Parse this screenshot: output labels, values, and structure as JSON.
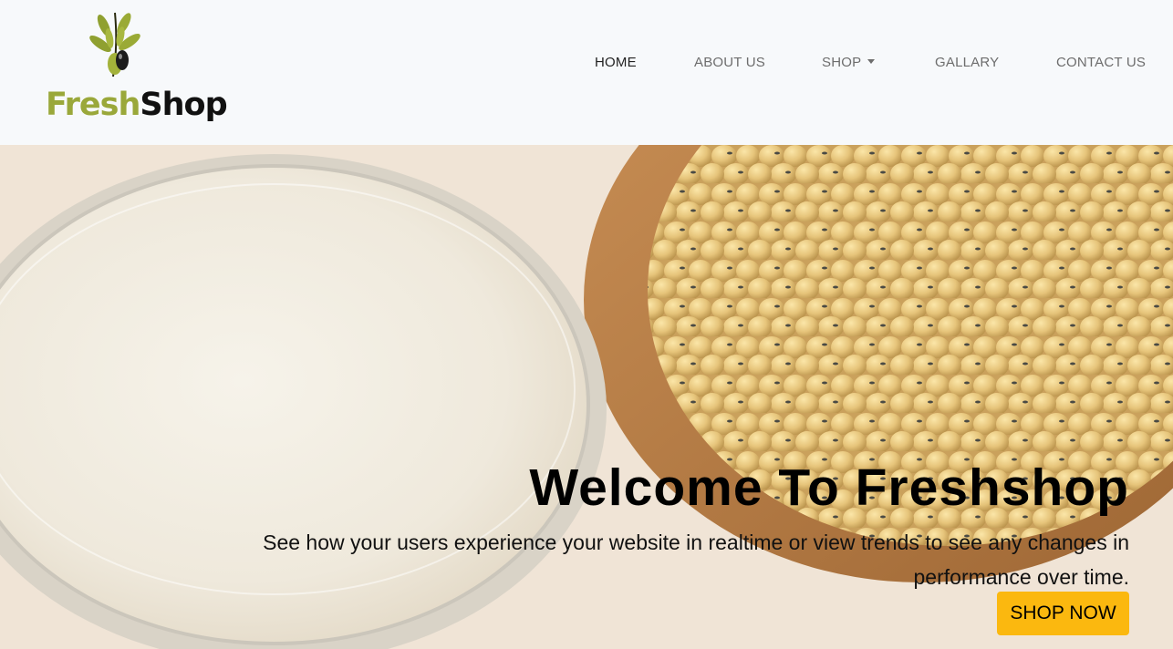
{
  "brand": {
    "name_part1": "Fresh",
    "name_part2": "Shop",
    "colors": {
      "fresh": "#9aa83a",
      "shop": "#111111",
      "olive_leaf": "#8fa030"
    },
    "icon": "olive-branch-logo-icon"
  },
  "nav": {
    "items": [
      {
        "label": "HOME",
        "active": true
      },
      {
        "label": "ABOUT US",
        "active": false
      },
      {
        "label": "SHOP",
        "active": false,
        "dropdown": true
      },
      {
        "label": "GALLARY",
        "active": false
      },
      {
        "label": "CONTACT US",
        "active": false
      }
    ]
  },
  "hero": {
    "title": "Welcome To Freshshop",
    "subtitle": "See how your users experience your website in realtime or view trends to see any changes in performance over time.",
    "cta_label": "SHOP NOW",
    "cta_color": "#fbb80f",
    "image": "glass-of-soy-milk-and-bowl-of-soybeans"
  }
}
